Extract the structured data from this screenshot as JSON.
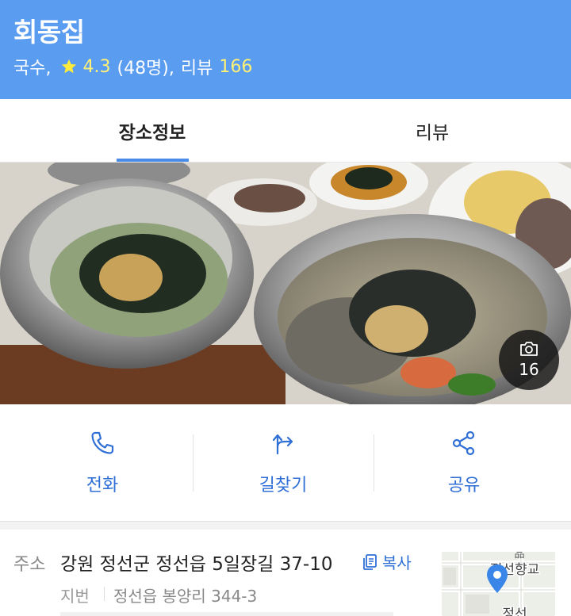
{
  "header": {
    "name": "회동집",
    "category": "국수,",
    "rating": "4.3",
    "rating_count": "(48명),",
    "review_label": "리뷰",
    "review_count": "166",
    "star_icon": "star-icon"
  },
  "tabs": [
    {
      "label": "장소정보",
      "active": true
    },
    {
      "label": "리뷰",
      "active": false
    }
  ],
  "photo": {
    "count": "16",
    "icon": "camera-icon"
  },
  "actions": [
    {
      "label": "전화",
      "icon": "phone-icon"
    },
    {
      "label": "길찾기",
      "icon": "directions-icon"
    },
    {
      "label": "공유",
      "icon": "share-icon"
    }
  ],
  "address": {
    "label": "주소",
    "road": "강원 정선군 정선읍 5일장길 37-10",
    "copy_label": "복사",
    "lot_label": "지번",
    "lot_value": "정선읍 봉양리 344-3",
    "map_label_1": "정선향교",
    "map_label_2": "정선"
  },
  "colors": {
    "header": "#5a9cf0",
    "accent": "#2f6fd6",
    "highlight": "#fff176"
  }
}
